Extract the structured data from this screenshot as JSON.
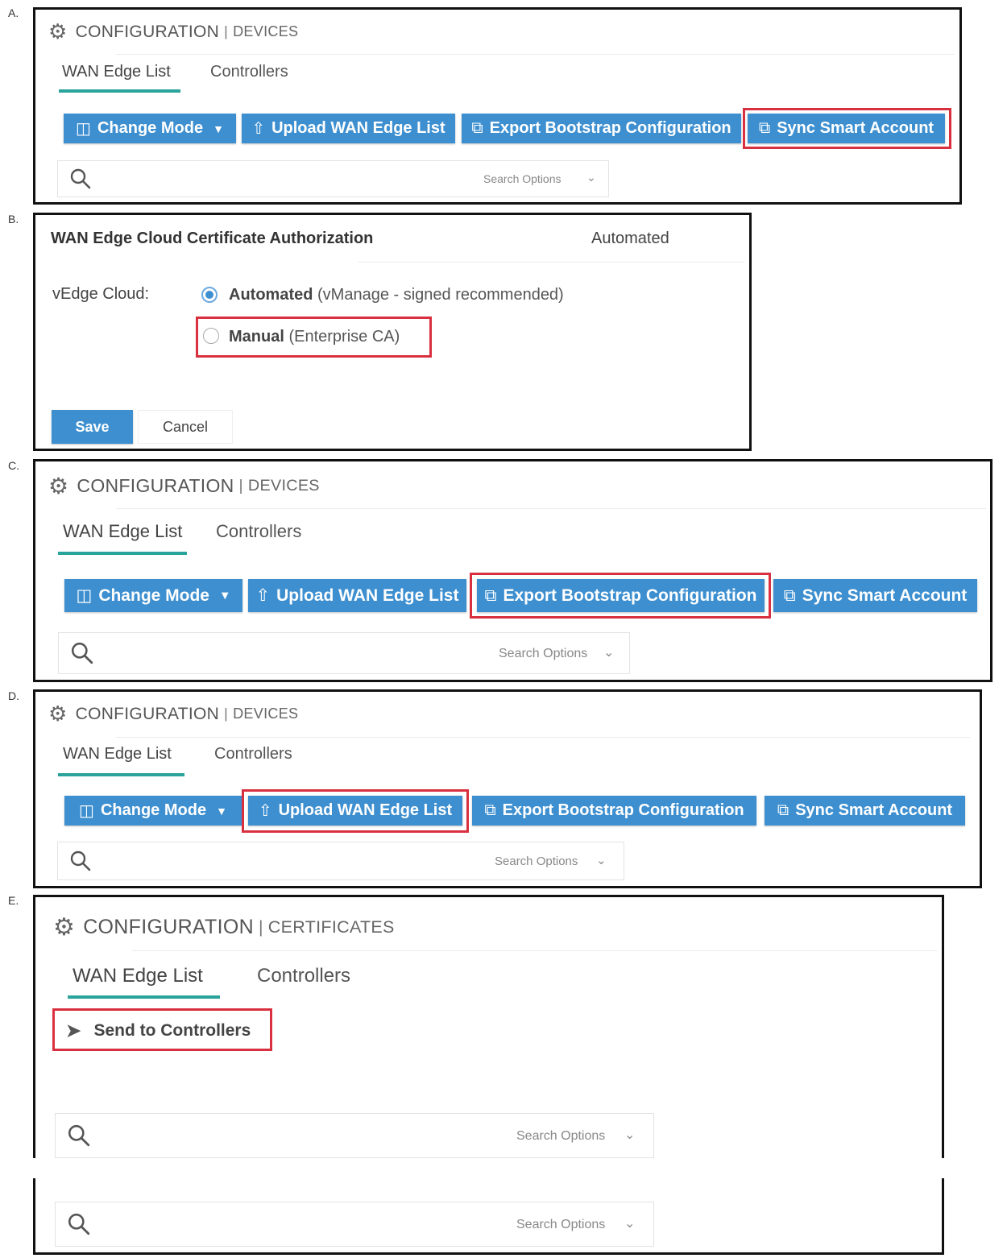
{
  "labels": {
    "a": "A.",
    "b": "B.",
    "c": "C.",
    "d": "D.",
    "e": "E."
  },
  "panel_a": {
    "header": {
      "main": "CONFIGURATION",
      "sep": "|",
      "sub": "DEVICES"
    },
    "tabs": [
      "WAN Edge List",
      "Controllers"
    ],
    "buttons": [
      "Change Mode",
      "Upload WAN Edge List",
      "Export Bootstrap Configuration",
      "Sync Smart Account"
    ],
    "search_options": "Search Options"
  },
  "panel_b": {
    "title": "WAN Edge Cloud Certificate Authorization",
    "current_value": "Automated",
    "field_label": "vEdge Cloud:",
    "option_automated": "Automated",
    "option_automated_detail": "(vManage - signed recommended)",
    "option_manual": "Manual",
    "option_manual_detail": "(Enterprise CA)",
    "save": "Save",
    "cancel": "Cancel"
  },
  "panel_c": {
    "header": {
      "main": "CONFIGURATION",
      "sep": "|",
      "sub": "DEVICES"
    },
    "tabs": [
      "WAN Edge List",
      "Controllers"
    ],
    "buttons": [
      "Change Mode",
      "Upload WAN Edge List",
      "Export Bootstrap Configuration",
      "Sync Smart Account"
    ],
    "search_options": "Search Options"
  },
  "panel_d": {
    "header": {
      "main": "CONFIGURATION",
      "sep": "|",
      "sub": "DEVICES"
    },
    "tabs": [
      "WAN Edge List",
      "Controllers"
    ],
    "buttons": [
      "Change Mode",
      "Upload WAN Edge List",
      "Export Bootstrap Configuration",
      "Sync Smart Account"
    ],
    "search_options": "Search Options"
  },
  "panel_e": {
    "header": {
      "main": "CONFIGURATION",
      "sep": "|",
      "sub": "CERTIFICATES"
    },
    "tabs": [
      "WAN Edge List",
      "Controllers"
    ],
    "send_button": "Send to Controllers",
    "search_options": "Search Options"
  },
  "colors": {
    "button_blue": "#3d8fd0",
    "highlight_red": "#d9303f",
    "tab_teal": "#2aa39a"
  },
  "icons": [
    "gear-icon",
    "change-mode-icon",
    "upload-icon",
    "export-icon",
    "sync-icon",
    "search-icon",
    "chevron-down-icon",
    "send-icon"
  ]
}
